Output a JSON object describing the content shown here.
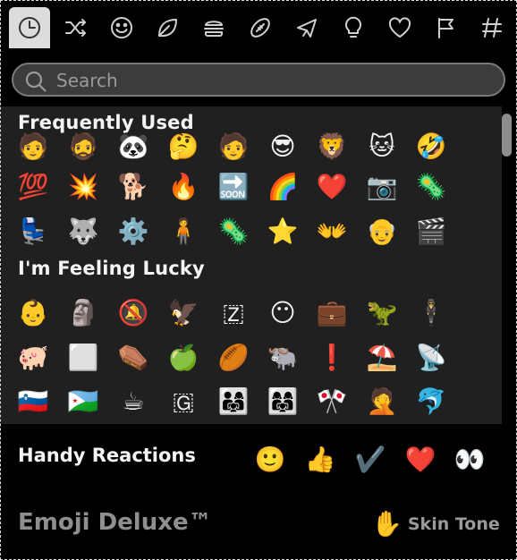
{
  "tabs": [
    {
      "name": "recent-tab",
      "icon": "clock-icon",
      "active": true
    },
    {
      "name": "shuffle-tab",
      "icon": "shuffle-icon"
    },
    {
      "name": "smileys-tab",
      "icon": "smiley-icon"
    },
    {
      "name": "nature-tab",
      "icon": "leaf-icon"
    },
    {
      "name": "food-tab",
      "icon": "burger-icon"
    },
    {
      "name": "activity-tab",
      "icon": "football-icon"
    },
    {
      "name": "travel-tab",
      "icon": "airplane-icon"
    },
    {
      "name": "objects-tab",
      "icon": "lightbulb-icon"
    },
    {
      "name": "symbols-tab",
      "icon": "heart-icon"
    },
    {
      "name": "flags-tab",
      "icon": "flag-icon"
    },
    {
      "name": "custom-tab",
      "icon": "slack-icon"
    }
  ],
  "search": {
    "placeholder": "Search",
    "value": ""
  },
  "sections": {
    "frequent_title": "Frequently Used",
    "lucky_title": "I'm Feeling Lucky"
  },
  "frequent_rows": [
    [
      "custom-face-1",
      "custom-face-2",
      "panda-face",
      "thinking-face",
      "custom-face-3",
      "custom-face-4",
      "custom-face-5",
      "cat-face",
      "rolling-laughing-face"
    ],
    [
      "hundred-points",
      "boom-sticker",
      "custom-dog",
      "fire",
      "soon-arrow",
      "custom-sparkle",
      "red-heart",
      "custom-photo",
      "party-blob"
    ],
    [
      "blue-chair",
      "custom-dog-face",
      "gear-parrot",
      "custom-man",
      "party-blob",
      "patrick-star",
      "sign-language",
      "custom-face-6",
      "custom-meeting"
    ]
  ],
  "frequent_glyphs": [
    [
      "🧑",
      "🧔",
      "🐼",
      "🤔",
      "🧑",
      "😎",
      "🦁",
      "🐱",
      "🤣"
    ],
    [
      "💯",
      "💥",
      "🐕",
      "🔥",
      "🔜",
      "🌈",
      "❤️",
      "📷",
      "🦠"
    ],
    [
      "💺",
      "🐺",
      "⚙️",
      "🧍",
      "🦠",
      "⭐",
      "👐",
      "👴",
      "🎬"
    ]
  ],
  "lucky_rows": [
    [
      "baby-face",
      "moai-figure",
      "no-bell",
      "eagle",
      "scrabble-z",
      "dreadlocks-face",
      "briefcase",
      "t-rex",
      "man-in-suit"
    ],
    [
      "pig",
      "white-square",
      "coffin",
      "green-apple",
      "rugby-ball",
      "water-buffalo",
      "exclamation-mark",
      "beach-umbrella",
      "satellite-antenna"
    ],
    [
      "flag-slovenia",
      "flag-djibouti",
      "hot-beverage",
      "scrabble-g",
      "family",
      "family-women",
      "crossed-flags",
      "facepalm-person",
      "dolphin"
    ]
  ],
  "lucky_glyphs": [
    [
      "👶",
      "🗿",
      "🔕",
      "🦅",
      "🇿",
      "😶",
      "💼",
      "🦖",
      "🕴️"
    ],
    [
      "🐖",
      "⬜",
      "⚰️",
      "🍏",
      "🏉",
      "🐃",
      "❗",
      "⛱️",
      "📡"
    ],
    [
      "🇸🇮",
      "🇩🇯",
      "☕",
      "🇬",
      "👨‍👩‍👧",
      "👩‍👩‍👧",
      "🎌",
      "🤦",
      "🐬"
    ]
  ],
  "handy": {
    "title": "Handy Reactions",
    "reactions": [
      {
        "name": "slightly-smiling-face",
        "glyph": "🙂"
      },
      {
        "name": "thumbs-up",
        "glyph": "👍"
      },
      {
        "name": "check-mark",
        "glyph": "✔️"
      },
      {
        "name": "red-heart",
        "glyph": "❤️"
      },
      {
        "name": "eyes",
        "glyph": "👀"
      }
    ]
  },
  "footer": {
    "brand": "Emoji Deluxe™",
    "skin_icon": "✋",
    "skin_label": "Skin Tone"
  }
}
